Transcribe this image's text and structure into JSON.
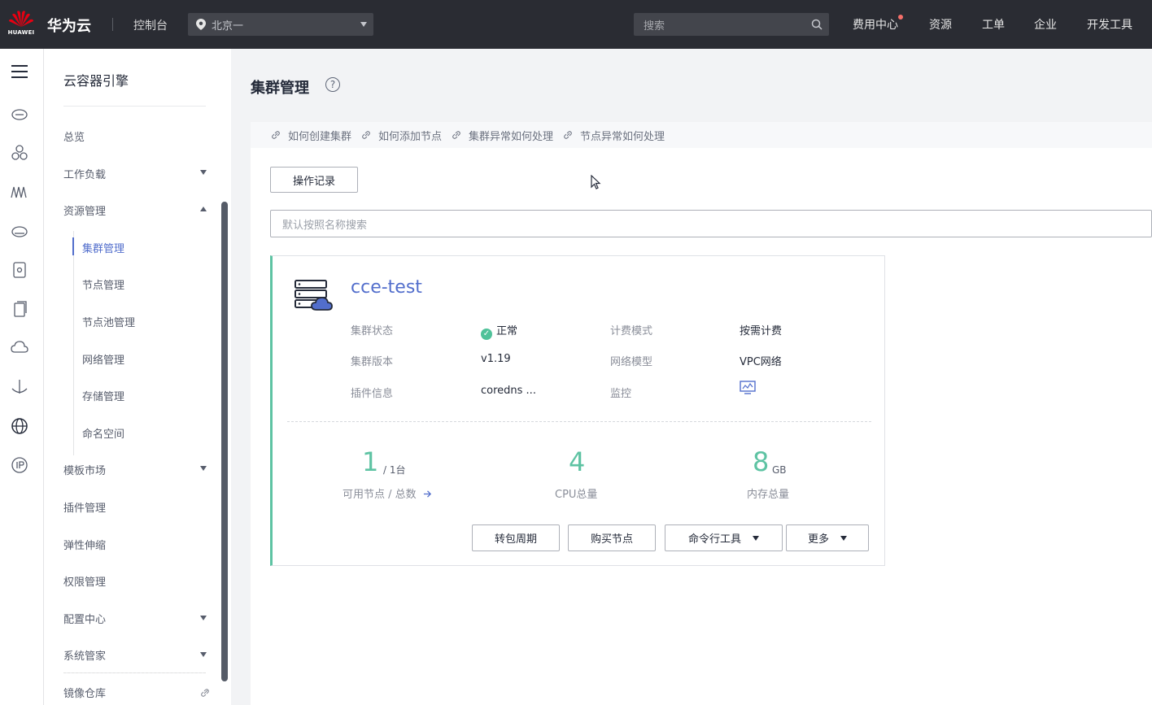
{
  "header": {
    "logo_text": "HUAWEI",
    "brand": "华为云",
    "console": "控制台",
    "region": "北京一",
    "search_placeholder": "搜索",
    "nav": [
      "费用中心",
      "资源",
      "工单",
      "企业",
      "开发工具"
    ]
  },
  "menu": {
    "title": "云容器引擎",
    "items": {
      "overview": "总览",
      "workloads": "工作负载",
      "resources": "资源管理",
      "cluster_mgmt": "集群管理",
      "node_mgmt": "节点管理",
      "nodepool_mgmt": "节点池管理",
      "network_mgmt": "网络管理",
      "storage_mgmt": "存储管理",
      "namespace": "命名空间",
      "templates": "模板市场",
      "addons": "插件管理",
      "autoscaling": "弹性伸缩",
      "permissions": "权限管理",
      "config_center": "配置中心",
      "system_manager": "系统管家",
      "image_repo": "镜像仓库"
    }
  },
  "page": {
    "title": "集群管理",
    "help": "?",
    "tips": [
      "如何创建集群",
      "如何添加节点",
      "集群异常如何处理",
      "节点异常如何处理"
    ],
    "operation_log": "操作记录",
    "search_placeholder": "默认按照名称搜索"
  },
  "cluster": {
    "name": "cce-test",
    "status_label": "集群状态",
    "status_value": "正常",
    "billing_label": "计费模式",
    "billing_value": "按需计费",
    "version_label": "集群版本",
    "version_value": "v1.19",
    "network_label": "网络模型",
    "network_value": "VPC网络",
    "addon_label": "插件信息",
    "addon_value": "coredns ...",
    "monitor_label": "监控",
    "nodes_available": "1",
    "nodes_total": "/ 1台",
    "nodes_label": "可用节点 / 总数",
    "cpu": "4",
    "cpu_label": "CPU总量",
    "memory": "8",
    "memory_unit": "GB",
    "memory_label": "内存总量",
    "buttons": {
      "convert": "转包周期",
      "buy_node": "购买节点",
      "cli": "命令行工具",
      "more": "更多"
    }
  },
  "colors": {
    "topbar": "#2a2c33",
    "accent": "#526ecc",
    "success": "#5ec3a3"
  }
}
